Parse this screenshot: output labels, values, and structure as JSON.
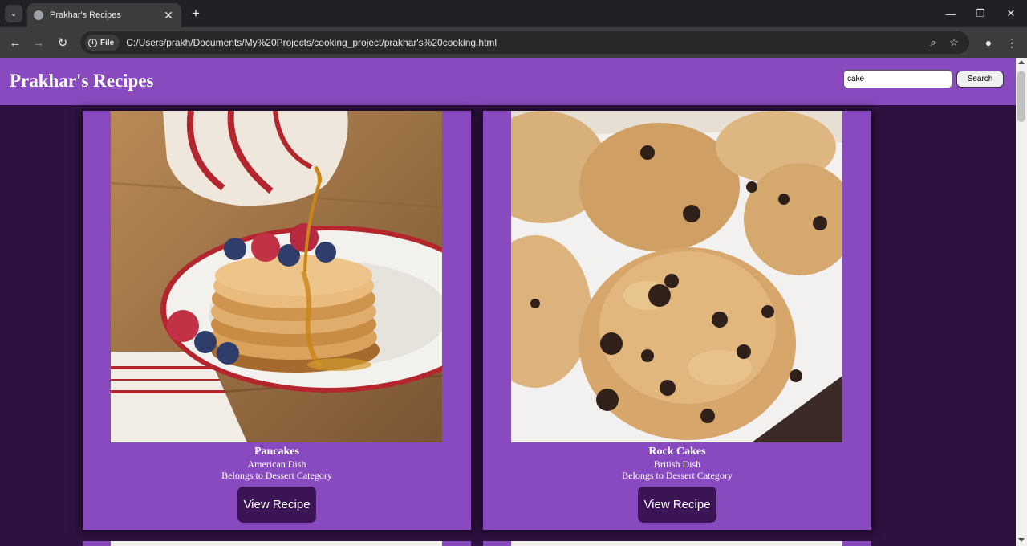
{
  "browser": {
    "tab_title": "Prakhar's Recipes",
    "new_tab_symbol": "+",
    "close_tab_symbol": "✕",
    "url_chip": "File",
    "url": "C:/Users/prakh/Documents/My%20Projects/cooking_project/prakhar's%20cooking.html",
    "icons": [
      "tab-list-icon",
      "favicon-globe-icon",
      "close-icon",
      "plus-icon",
      "minimize-icon",
      "restore-icon",
      "window-close-icon",
      "back-arrow-icon",
      "forward-arrow-icon",
      "reload-icon",
      "info-icon",
      "zoom-icon",
      "star-icon",
      "profile-icon",
      "kebab-menu-icon"
    ]
  },
  "header": {
    "title": "Prakhar's Recipes",
    "search_value": "cake",
    "search_button": "Search"
  },
  "recipes": [
    {
      "name": "Pancakes",
      "area": "American Dish",
      "category": "Belongs to Dessert Category",
      "button": "View Recipe"
    },
    {
      "name": "Rock Cakes",
      "area": "British Dish",
      "category": "Belongs to Dessert Category",
      "button": "View Recipe"
    }
  ],
  "colors": {
    "header_bg": "#8a4abf",
    "page_bg": "#2e1140",
    "card_bg": "#8a4abf",
    "button_bg": "#3a1454",
    "chrome_dark": "#202124",
    "chrome_toolbar": "#3c3c3c"
  }
}
